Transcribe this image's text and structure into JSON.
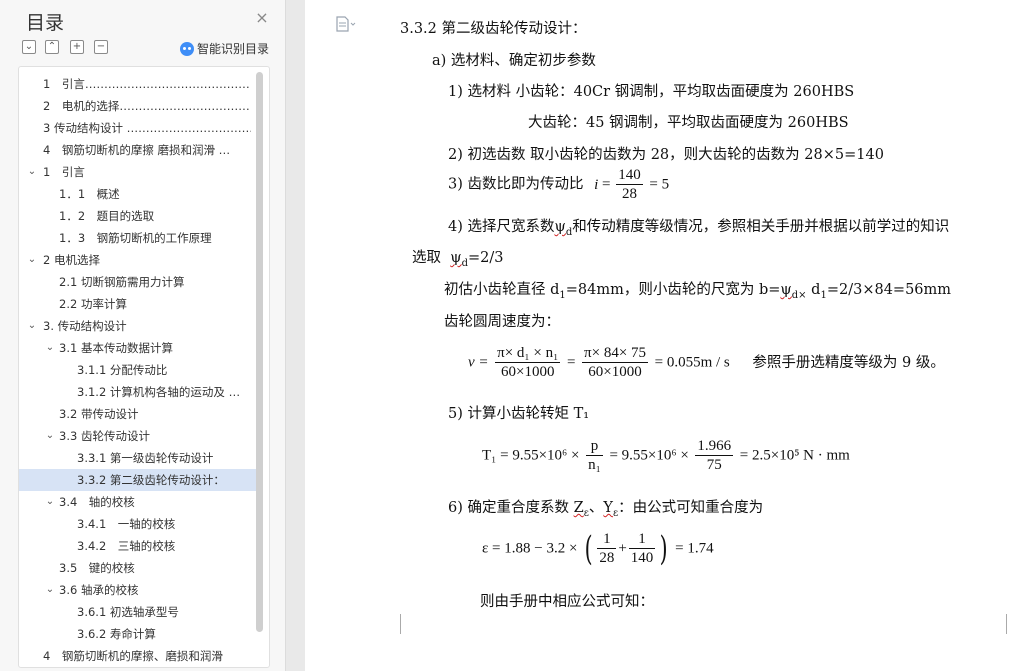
{
  "sidebar": {
    "title": "目录",
    "close_glyph": "×",
    "tools": [
      "⌄",
      "⌃",
      "+",
      "−"
    ],
    "ai_label": "智能识别目录",
    "toc": [
      {
        "label": "1　引言………………………………………",
        "level": 0,
        "chev": ""
      },
      {
        "label": "2　电机的选择…………………………………",
        "level": 0,
        "chev": ""
      },
      {
        "label": "3 传动结构设计 ………………………………",
        "level": 0,
        "chev": ""
      },
      {
        "label": "4　钢筋切断机的摩擦 磨损和润滑 …",
        "level": 0,
        "chev": ""
      },
      {
        "label": "1　引言",
        "level": 0,
        "chev": "v"
      },
      {
        "label": "1．1　概述",
        "level": 1,
        "chev": ""
      },
      {
        "label": "1．2　题目的选取",
        "level": 1,
        "chev": ""
      },
      {
        "label": "1．3　钢筋切断机的工作原理",
        "level": 1,
        "chev": ""
      },
      {
        "label": "2 电机选择",
        "level": 0,
        "chev": "v"
      },
      {
        "label": "2.1 切断钢筋需用力计算",
        "level": 1,
        "chev": ""
      },
      {
        "label": "2.2  功率计算",
        "level": 1,
        "chev": ""
      },
      {
        "label": "3. 传动结构设计",
        "level": 0,
        "chev": "v"
      },
      {
        "label": "3.1  基本传动数据计算",
        "level": 1,
        "chev": "v"
      },
      {
        "label": "3.1.1  分配传动比",
        "level": 2,
        "chev": ""
      },
      {
        "label": "3.1.2  计算机构各轴的运动及 …",
        "level": 2,
        "chev": ""
      },
      {
        "label": "3.2  带传动设计",
        "level": 1,
        "chev": ""
      },
      {
        "label": "3.3  齿轮传动设计",
        "level": 1,
        "chev": "v"
      },
      {
        "label": "3.3.1  第一级齿轮传动设计",
        "level": 2,
        "chev": ""
      },
      {
        "label": "3.3.2  第二级齿轮传动设计：",
        "level": 2,
        "chev": "",
        "selected": true
      },
      {
        "label": "3.4　轴的校核",
        "level": 1,
        "chev": "v"
      },
      {
        "label": "3.4.1　一轴的校核",
        "level": 2,
        "chev": ""
      },
      {
        "label": "3.4.2　三轴的校核",
        "level": 2,
        "chev": ""
      },
      {
        "label": "3.5　键的校核",
        "level": 1,
        "chev": ""
      },
      {
        "label": "3.6  轴承的校核",
        "level": 1,
        "chev": "v"
      },
      {
        "label": "3.6.1  初选轴承型号",
        "level": 2,
        "chev": ""
      },
      {
        "label": "3.6.2 寿命计算",
        "level": 2,
        "chev": ""
      },
      {
        "label": "4　钢筋切断机的摩擦、磨损和润滑",
        "level": 0,
        "chev": ""
      }
    ]
  },
  "doc": {
    "heading": "3.3.2  第二级齿轮传动设计：",
    "a_title": "a)  选材料、确定初步参数",
    "item1_a": "1)  选材料  小齿轮：40Cr 钢调制，平均取齿面硬度为 260HBS",
    "item1_b": "大齿轮：45 钢调制，平均取齿面硬度为 260HBS",
    "item2": "2)  初选齿数  取小齿轮的齿数为 28，则大齿轮的齿数为 28×5=140",
    "item3_pre": "3)  齿数比即为传动比",
    "item3_i": "i",
    "item3_num": "140",
    "item3_den": "28",
    "item3_res": "= 5",
    "item4_a_pre": "4)  选择尺宽系数",
    "psi": "ψ",
    "psi_sub": "d",
    "item4_a_post": "和传动精度等级情况，参照相关手册并根据以前学过的知识",
    "item4_b_pre": "选取",
    "item4_b_post": "=2/3",
    "est_pre": "初估小齿轮直径 d",
    "est_sub1": "1",
    "est_mid": "=84mm，则小齿轮的尺宽为 b=",
    "est_sub2": "d×",
    "est_mid2": " d",
    "est_sub3": "1",
    "est_post": "=2/3×84=56mm",
    "speed_label": "齿轮圆周速度为：",
    "v_lhs": "v =",
    "v_num1": "π× d₁ × n₁",
    "v_den1": "60×1000",
    "v_num2": "π× 84× 75",
    "v_den2": "60×1000",
    "v_res": "= 0.055m / s",
    "v_note": "参照手册选精度等级为 9 级。",
    "item5": "5)  计算小齿轮转矩 T₁",
    "t_lhs": "T₁ = 9.55×10⁶ ×",
    "t_num1": "p",
    "t_den1": "n₁",
    "t_mid": "= 9.55×10⁶ ×",
    "t_num2": "1.966",
    "t_den2": "75",
    "t_res": "= 2.5×10⁵ N · mm",
    "item6_pre": "6)  确定重合度系数",
    "z_eps": "Z",
    "y_eps": "Y",
    "eps_sub": "ε",
    "item6_sep": "、",
    "item6_post": "：由公式可知重合度为",
    "e_lhs": "ε = 1.88 − 3.2 ×",
    "e_num1": "1",
    "e_den1": "28",
    "e_plus": "+",
    "e_num2": "1",
    "e_den2": "140",
    "e_res": "= 1.74",
    "e_open": "(",
    "e_close": ")",
    "last": "则由手册中相应公式可知："
  }
}
